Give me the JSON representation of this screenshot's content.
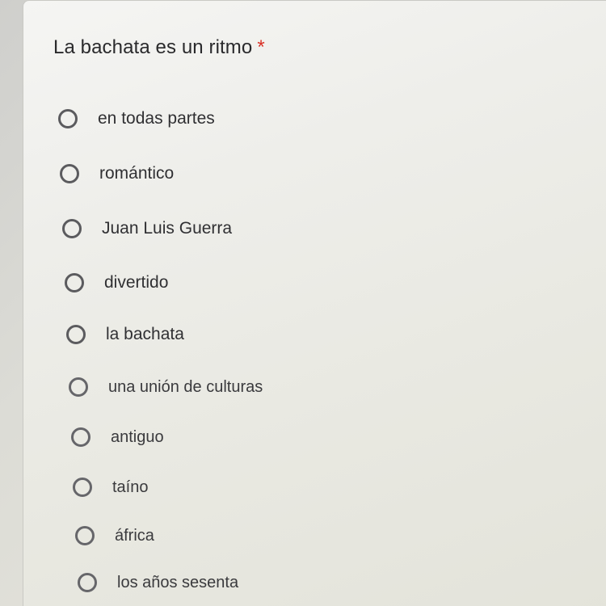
{
  "question": {
    "title": "La bachata es un ritmo",
    "required_marker": "*"
  },
  "options": [
    {
      "label": "en todas partes"
    },
    {
      "label": "romántico"
    },
    {
      "label": "Juan Luis Guerra"
    },
    {
      "label": "divertido"
    },
    {
      "label": "la bachata"
    },
    {
      "label": "una unión de culturas"
    },
    {
      "label": "antiguo"
    },
    {
      "label": "taíno"
    },
    {
      "label": "áfrica"
    },
    {
      "label": "los años sesenta"
    }
  ],
  "colors": {
    "required": "#d93025",
    "text": "#2a2a2c",
    "radio_border": "#5b5b5e"
  }
}
